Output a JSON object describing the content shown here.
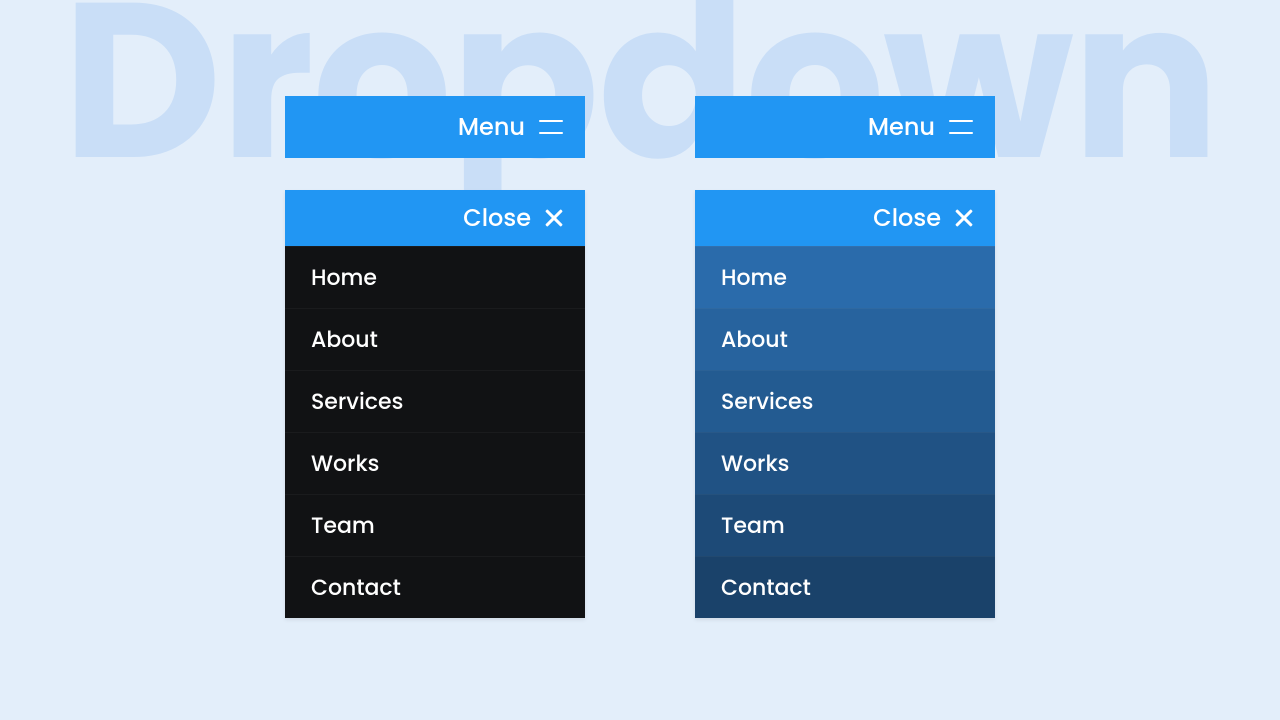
{
  "background_word": "Dropdown",
  "menu_label": "Menu",
  "close_label": "Close",
  "items": [
    "Home",
    "About",
    "Services",
    "Works",
    "Team",
    "Contact"
  ],
  "colors": {
    "accent": "#2196f3",
    "page_bg": "#e3eefa",
    "bg_word": "#c9def7",
    "dark_item": "#111214",
    "blue_shades": [
      "#2a6bab",
      "#27639e",
      "#235b91",
      "#205284",
      "#1d4a77",
      "#1a426a"
    ]
  }
}
